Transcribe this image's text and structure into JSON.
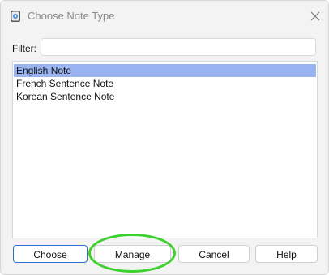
{
  "window": {
    "title": "Choose Note Type"
  },
  "icons": {
    "app": "anki-app-icon",
    "close": "close-icon"
  },
  "filter": {
    "label": "Filter:",
    "value": "",
    "placeholder": ""
  },
  "note_types": {
    "items": [
      {
        "label": "English Note",
        "selected": true
      },
      {
        "label": "French Sentence Note",
        "selected": false
      },
      {
        "label": "Korean Sentence Note",
        "selected": false
      }
    ]
  },
  "buttons": {
    "choose": "Choose",
    "manage": "Manage",
    "cancel": "Cancel",
    "help": "Help"
  },
  "colors": {
    "selection": "#99b4f0",
    "default_button_border": "#2b6fd6",
    "annotation_ring": "#3ed12d"
  }
}
